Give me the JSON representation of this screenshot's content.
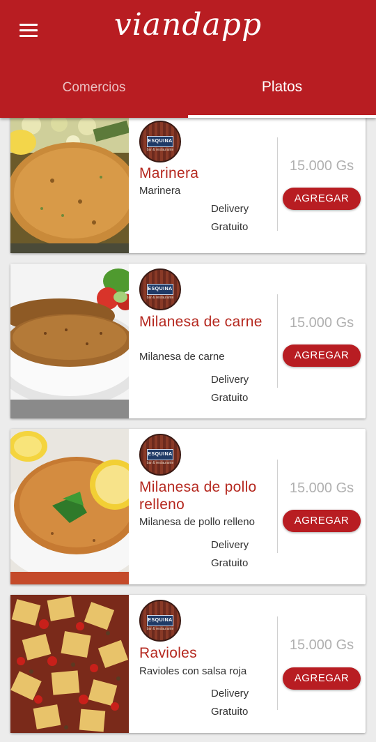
{
  "app": {
    "title": "viandapp"
  },
  "tabs": [
    {
      "label": "Comercios",
      "active": false
    },
    {
      "label": "Platos",
      "active": true
    }
  ],
  "dishes": [
    {
      "name": "Marinera",
      "description": "Marinera",
      "delivery_line1": "Delivery",
      "delivery_line2": "Gratuito",
      "price": "15.000 Gs",
      "button": "AGREGAR",
      "image": "breaded-fish-photo"
    },
    {
      "name": "Milanesa de carne",
      "description": "Milanesa de carne",
      "delivery_line1": "Delivery",
      "delivery_line2": "Gratuito",
      "price": "15.000 Gs",
      "button": "AGREGAR",
      "image": "milanesa-photo"
    },
    {
      "name": "Milanesa de pollo relleno",
      "description": "Milanesa de pollo relleno",
      "delivery_line1": "Delivery",
      "delivery_line2": "Gratuito",
      "price": "15.000 Gs",
      "button": "AGREGAR",
      "image": "chicken-milanesa-photo"
    },
    {
      "name": "Ravioles",
      "description": "Ravioles con salsa roja",
      "delivery_line1": "Delivery",
      "delivery_line2": "Gratuito",
      "price": "15.000 Gs",
      "button": "AGREGAR",
      "image": "ravioli-photo"
    }
  ],
  "restaurant_badge": {
    "label": "ESQUINA",
    "icon": "restaurant-logo-icon"
  },
  "colors": {
    "primary": "#b81d22",
    "dish_name": "#b5281f",
    "price": "#b0b0b0"
  }
}
